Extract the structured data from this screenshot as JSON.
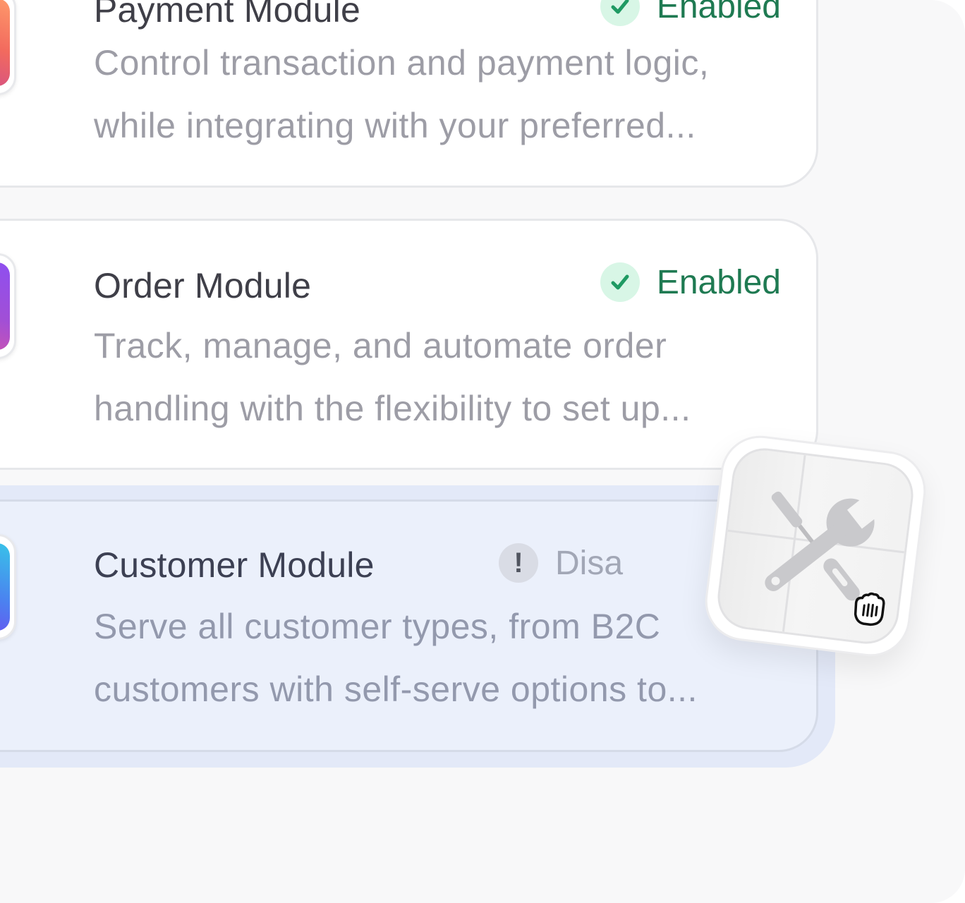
{
  "modules": [
    {
      "id": "payment",
      "title": "Payment Module",
      "description": "Control transaction and payment logic, while integrating with your preferred...",
      "status": "Enabled",
      "icon": "wallet-icon"
    },
    {
      "id": "order",
      "title": "Order Module",
      "description": "Track, manage, and automate order handling with the flexibility to set up...",
      "status": "Enabled",
      "icon": "shopping-bag-check-icon"
    },
    {
      "id": "customer",
      "title": "Customer Module",
      "description": "Serve all customer types, from B2C customers with self-serve options to...",
      "status": "Disa",
      "icon": "users-icon"
    }
  ],
  "drag_item": {
    "icon": "tools-icon",
    "cursor": "grab-cursor-icon"
  },
  "colors": {
    "enabled_text": "#1f7a52",
    "enabled_badge": "#d8f6e6",
    "disabled_text": "#a2a7b6",
    "drop_zone": "#e3e9f8"
  }
}
